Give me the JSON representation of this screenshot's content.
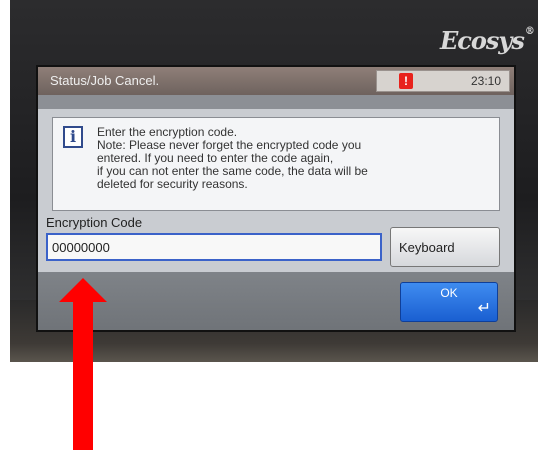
{
  "device": {
    "brand": "Ecosys",
    "brand_mark": "®"
  },
  "screen": {
    "title": "Status/Job Cancel.",
    "alert_symbol": "!",
    "time": "23:10"
  },
  "message": {
    "icon": "info-icon",
    "lines": [
      "Enter the encryption code.",
      "Note: Please never forget the encrypted code you",
      "entered. If you need to enter the code again,",
      "if you can not enter the same code, the data will be",
      "deleted for security reasons."
    ]
  },
  "form": {
    "label": "Encryption Code",
    "value": "00000000",
    "keyboard_label": "Keyboard"
  },
  "actions": {
    "ok_label": "OK",
    "enter_icon": "enter-icon"
  },
  "annotation": {
    "arrow_color": "#ff0000"
  }
}
